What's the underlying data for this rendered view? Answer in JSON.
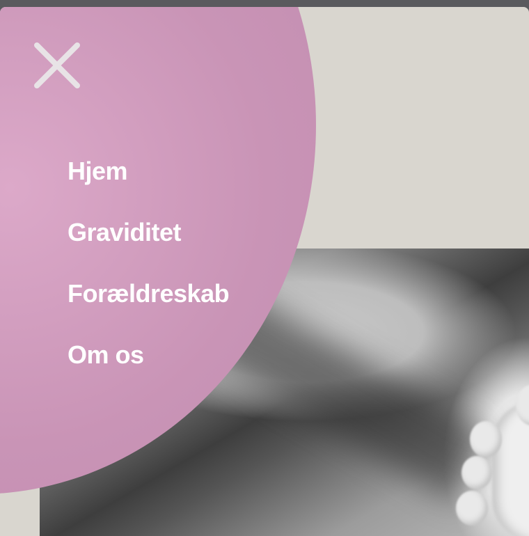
{
  "menu": {
    "close_icon": "close-icon",
    "items": [
      {
        "label": "Hjem"
      },
      {
        "label": "Graviditet"
      },
      {
        "label": "Forældreskab"
      },
      {
        "label": "Om os"
      }
    ]
  },
  "hero": {
    "image_description": "black-and-white photo of a baby's foot"
  },
  "colors": {
    "menu_background": "#c994b6",
    "menu_text": "#ffffff",
    "page_background": "#d9d6cf",
    "window_frame": "#5a5a5e"
  }
}
